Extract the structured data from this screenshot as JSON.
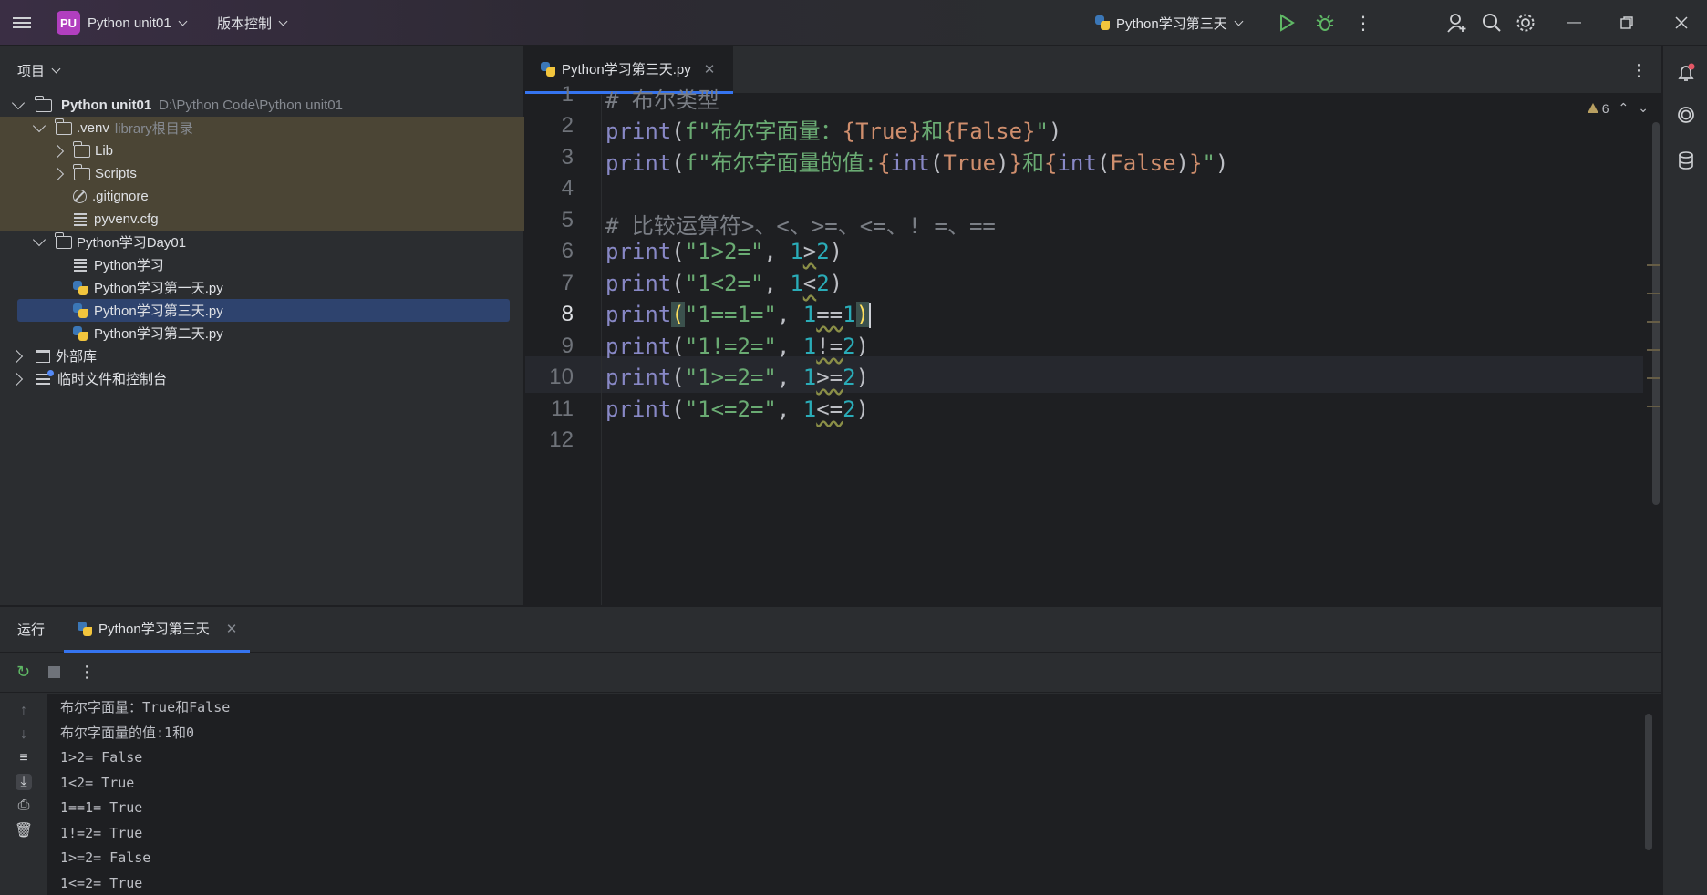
{
  "titlebar": {
    "project_badge": "PU",
    "project_name": "Python unit01",
    "vcs_label": "版本控制",
    "run_config": "Python学习第三天",
    "accent_color": "#3574f0"
  },
  "project_panel": {
    "header": "项目",
    "tree": [
      {
        "label": "Python unit01",
        "path": "D:\\Python Code\\Python unit01"
      },
      {
        "label": ".venv",
        "hint": "library根目录"
      },
      {
        "label": "Lib"
      },
      {
        "label": "Scripts"
      },
      {
        "label": ".gitignore"
      },
      {
        "label": "pyvenv.cfg"
      },
      {
        "label": "Python学习Day01"
      },
      {
        "label": "Python学习"
      },
      {
        "label": "Python学习第一天.py"
      },
      {
        "label": "Python学习第三天.py"
      },
      {
        "label": "Python学习第二天.py"
      },
      {
        "label": "外部库"
      },
      {
        "label": "临时文件和控制台"
      }
    ]
  },
  "editor": {
    "tab_label": "Python学习第三天.py",
    "warning_count": "6",
    "line_numbers": [
      "1",
      "2",
      "3",
      "4",
      "5",
      "6",
      "7",
      "8",
      "9",
      "10",
      "11",
      "12"
    ],
    "current_line": "8"
  },
  "run_panel": {
    "title": "运行",
    "tab_label": "Python学习第三天",
    "output": [
      "布尔字面量：True和False",
      "布尔字面量的值:1和0",
      "1>2= False",
      "1<2= True",
      "1==1= True",
      "1!=2= True",
      "1>=2= False",
      "1<=2= True"
    ]
  }
}
